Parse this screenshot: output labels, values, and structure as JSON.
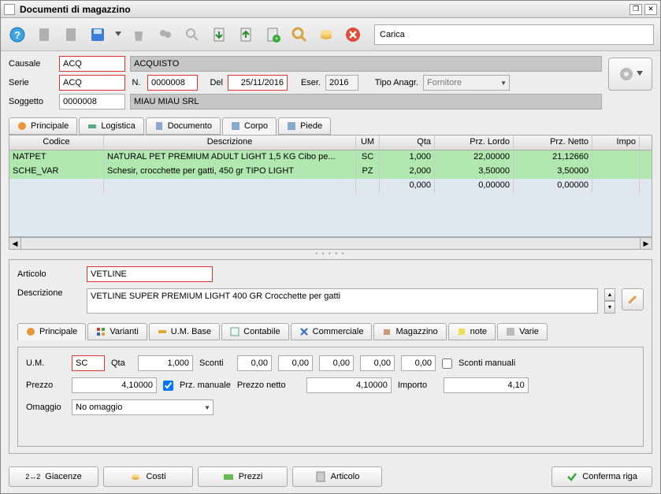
{
  "window": {
    "title": "Documenti di magazzino"
  },
  "toolbar": {
    "carica": "Carica"
  },
  "header": {
    "causale_label": "Causale",
    "causale_code": "ACQ",
    "causale_desc": "ACQUISTO",
    "serie_label": "Serie",
    "serie_code": "ACQ",
    "n_label": "N.",
    "n_value": "0000008",
    "del_label": "Del",
    "del_value": "25/11/2016",
    "eser_label": "Eser.",
    "eser_value": "2016",
    "tipo_label": "Tipo Anagr.",
    "tipo_value": "Fornitore",
    "soggetto_label": "Soggetto",
    "soggetto_code": "0000008",
    "soggetto_desc": "MIAU MIAU SRL"
  },
  "tabs": {
    "principale": "Principale",
    "logistica": "Logistica",
    "documento": "Documento",
    "corpo": "Corpo",
    "piede": "Piede"
  },
  "grid": {
    "cols": {
      "codice": "Codice",
      "descrizione": "Descrizione",
      "um": "UM",
      "qta": "Qta",
      "lordo": "Prz. Lordo",
      "netto": "Prz. Netto",
      "impo": "Impo"
    },
    "rows": [
      {
        "codice": "NATPET",
        "descrizione": "NATURAL PET PREMIUM ADULT LIGHT 1,5 KG Cibo pe...",
        "um": "SC",
        "qta": "1,000",
        "lordo": "22,00000",
        "netto": "21,12660"
      },
      {
        "codice": "SCHE_VAR",
        "descrizione": "Schesir, crocchette per gatti, 450 gr TIPO LIGHT",
        "um": "PZ",
        "qta": "2,000",
        "lordo": "3,50000",
        "netto": "3,50000"
      }
    ],
    "empty": {
      "qta": "0,000",
      "lordo": "0,00000",
      "netto": "0,00000"
    }
  },
  "detail": {
    "articolo_label": "Articolo",
    "articolo_value": "VETLINE",
    "descrizione_label": "Descrizione",
    "descrizione_value": "VETLINE SUPER PREMIUM LIGHT 400 GR Crocchette per gatti",
    "subtabs": {
      "principale": "Principale",
      "varianti": "Varianti",
      "umbase": "U.M. Base",
      "contabile": "Contabile",
      "commerciale": "Commerciale",
      "magazzino": "Magazzino",
      "note": "note",
      "varie": "Varie"
    },
    "um_label": "U.M.",
    "um_value": "SC",
    "qta_label": "Qta",
    "qta_value": "1,000",
    "sconti_label": "Sconti",
    "sconti": [
      "0,00",
      "0,00",
      "0,00",
      "0,00",
      "0,00"
    ],
    "sconti_manuali_label": "Sconti manuali",
    "prezzo_label": "Prezzo",
    "prezzo_value": "4,10000",
    "prz_manuale_label": "Prz. manuale",
    "prezzo_netto_label": "Prezzo netto",
    "prezzo_netto_value": "4,10000",
    "importo_label": "Importo",
    "importo_value": "4,10",
    "omaggio_label": "Omaggio",
    "omaggio_value": "No omaggio"
  },
  "footer": {
    "giacenze": "Giacenze",
    "costi": "Costi",
    "prezzi": "Prezzi",
    "articolo": "Articolo",
    "conferma": "Conferma riga",
    "g_prefix": "2↔2"
  }
}
